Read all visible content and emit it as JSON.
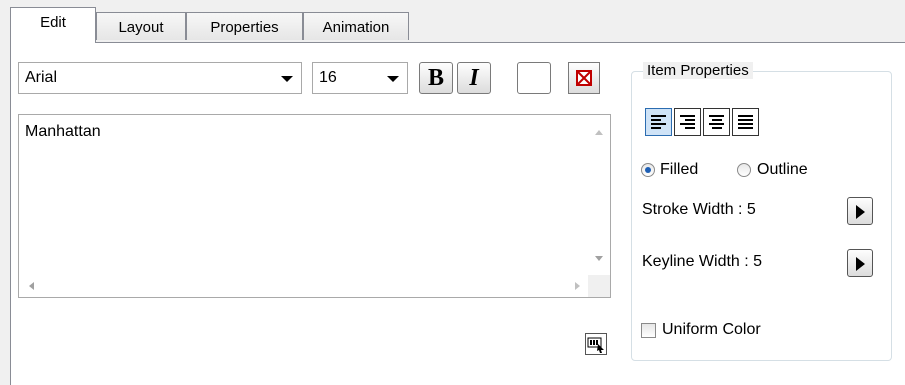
{
  "tabs": [
    {
      "label": "Edit",
      "active": true
    },
    {
      "label": "Layout",
      "active": false
    },
    {
      "label": "Properties",
      "active": false
    },
    {
      "label": "Animation",
      "active": false
    }
  ],
  "toolbar": {
    "font_family": "Arial",
    "font_size": "16",
    "bold_label": "B",
    "italic_label": "I",
    "text_color": "#ffffff",
    "no_color_icon": "no-color-icon"
  },
  "editor": {
    "text": "Manhattan"
  },
  "item_properties": {
    "title": "Item Properties",
    "alignment": [
      "align-left",
      "align-right",
      "align-center",
      "align-justify"
    ],
    "selected_alignment": "align-left",
    "fill_mode": {
      "options": [
        "Filled",
        "Outline"
      ],
      "selected": "Filled"
    },
    "stroke_width_label": "Stroke Width : 5",
    "keyline_width_label": "Keyline Width : 5",
    "uniform_color_label": "Uniform Color",
    "uniform_color_checked": false
  },
  "colors": {
    "accent": "#1e5fb4",
    "selected_button_bg": "#cfe3f7",
    "window_bg": "#f0f0f0"
  }
}
